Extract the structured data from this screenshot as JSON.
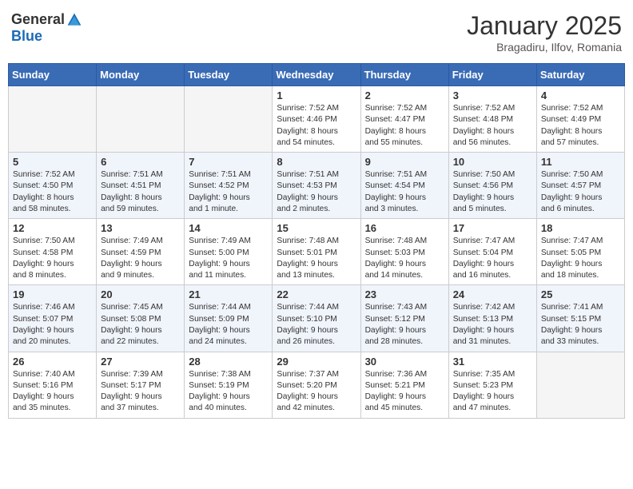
{
  "header": {
    "logo_general": "General",
    "logo_blue": "Blue",
    "month": "January 2025",
    "location": "Bragadiru, Ilfov, Romania"
  },
  "weekdays": [
    "Sunday",
    "Monday",
    "Tuesday",
    "Wednesday",
    "Thursday",
    "Friday",
    "Saturday"
  ],
  "weeks": [
    [
      {
        "day": "",
        "info": ""
      },
      {
        "day": "",
        "info": ""
      },
      {
        "day": "",
        "info": ""
      },
      {
        "day": "1",
        "info": "Sunrise: 7:52 AM\nSunset: 4:46 PM\nDaylight: 8 hours\nand 54 minutes."
      },
      {
        "day": "2",
        "info": "Sunrise: 7:52 AM\nSunset: 4:47 PM\nDaylight: 8 hours\nand 55 minutes."
      },
      {
        "day": "3",
        "info": "Sunrise: 7:52 AM\nSunset: 4:48 PM\nDaylight: 8 hours\nand 56 minutes."
      },
      {
        "day": "4",
        "info": "Sunrise: 7:52 AM\nSunset: 4:49 PM\nDaylight: 8 hours\nand 57 minutes."
      }
    ],
    [
      {
        "day": "5",
        "info": "Sunrise: 7:52 AM\nSunset: 4:50 PM\nDaylight: 8 hours\nand 58 minutes."
      },
      {
        "day": "6",
        "info": "Sunrise: 7:51 AM\nSunset: 4:51 PM\nDaylight: 8 hours\nand 59 minutes."
      },
      {
        "day": "7",
        "info": "Sunrise: 7:51 AM\nSunset: 4:52 PM\nDaylight: 9 hours\nand 1 minute."
      },
      {
        "day": "8",
        "info": "Sunrise: 7:51 AM\nSunset: 4:53 PM\nDaylight: 9 hours\nand 2 minutes."
      },
      {
        "day": "9",
        "info": "Sunrise: 7:51 AM\nSunset: 4:54 PM\nDaylight: 9 hours\nand 3 minutes."
      },
      {
        "day": "10",
        "info": "Sunrise: 7:50 AM\nSunset: 4:56 PM\nDaylight: 9 hours\nand 5 minutes."
      },
      {
        "day": "11",
        "info": "Sunrise: 7:50 AM\nSunset: 4:57 PM\nDaylight: 9 hours\nand 6 minutes."
      }
    ],
    [
      {
        "day": "12",
        "info": "Sunrise: 7:50 AM\nSunset: 4:58 PM\nDaylight: 9 hours\nand 8 minutes."
      },
      {
        "day": "13",
        "info": "Sunrise: 7:49 AM\nSunset: 4:59 PM\nDaylight: 9 hours\nand 9 minutes."
      },
      {
        "day": "14",
        "info": "Sunrise: 7:49 AM\nSunset: 5:00 PM\nDaylight: 9 hours\nand 11 minutes."
      },
      {
        "day": "15",
        "info": "Sunrise: 7:48 AM\nSunset: 5:01 PM\nDaylight: 9 hours\nand 13 minutes."
      },
      {
        "day": "16",
        "info": "Sunrise: 7:48 AM\nSunset: 5:03 PM\nDaylight: 9 hours\nand 14 minutes."
      },
      {
        "day": "17",
        "info": "Sunrise: 7:47 AM\nSunset: 5:04 PM\nDaylight: 9 hours\nand 16 minutes."
      },
      {
        "day": "18",
        "info": "Sunrise: 7:47 AM\nSunset: 5:05 PM\nDaylight: 9 hours\nand 18 minutes."
      }
    ],
    [
      {
        "day": "19",
        "info": "Sunrise: 7:46 AM\nSunset: 5:07 PM\nDaylight: 9 hours\nand 20 minutes."
      },
      {
        "day": "20",
        "info": "Sunrise: 7:45 AM\nSunset: 5:08 PM\nDaylight: 9 hours\nand 22 minutes."
      },
      {
        "day": "21",
        "info": "Sunrise: 7:44 AM\nSunset: 5:09 PM\nDaylight: 9 hours\nand 24 minutes."
      },
      {
        "day": "22",
        "info": "Sunrise: 7:44 AM\nSunset: 5:10 PM\nDaylight: 9 hours\nand 26 minutes."
      },
      {
        "day": "23",
        "info": "Sunrise: 7:43 AM\nSunset: 5:12 PM\nDaylight: 9 hours\nand 28 minutes."
      },
      {
        "day": "24",
        "info": "Sunrise: 7:42 AM\nSunset: 5:13 PM\nDaylight: 9 hours\nand 31 minutes."
      },
      {
        "day": "25",
        "info": "Sunrise: 7:41 AM\nSunset: 5:15 PM\nDaylight: 9 hours\nand 33 minutes."
      }
    ],
    [
      {
        "day": "26",
        "info": "Sunrise: 7:40 AM\nSunset: 5:16 PM\nDaylight: 9 hours\nand 35 minutes."
      },
      {
        "day": "27",
        "info": "Sunrise: 7:39 AM\nSunset: 5:17 PM\nDaylight: 9 hours\nand 37 minutes."
      },
      {
        "day": "28",
        "info": "Sunrise: 7:38 AM\nSunset: 5:19 PM\nDaylight: 9 hours\nand 40 minutes."
      },
      {
        "day": "29",
        "info": "Sunrise: 7:37 AM\nSunset: 5:20 PM\nDaylight: 9 hours\nand 42 minutes."
      },
      {
        "day": "30",
        "info": "Sunrise: 7:36 AM\nSunset: 5:21 PM\nDaylight: 9 hours\nand 45 minutes."
      },
      {
        "day": "31",
        "info": "Sunrise: 7:35 AM\nSunset: 5:23 PM\nDaylight: 9 hours\nand 47 minutes."
      },
      {
        "day": "",
        "info": ""
      }
    ]
  ]
}
